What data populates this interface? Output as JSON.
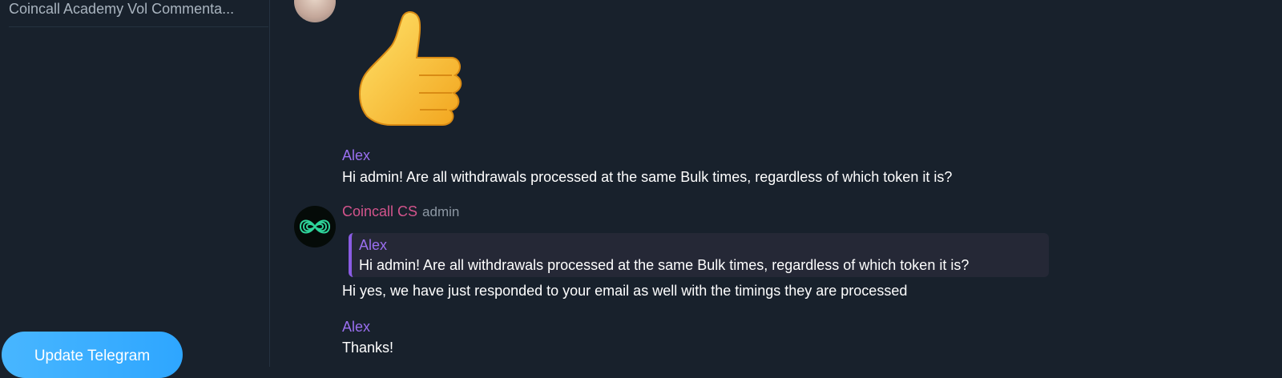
{
  "sidebar": {
    "chats": [
      {
        "title": "Coincall Academy Vol Commenta..."
      }
    ],
    "update_button": "Update Telegram"
  },
  "messages": [
    {
      "type": "sticker",
      "icon": "thumbs-up-sticker"
    },
    {
      "sender": "Alex",
      "sender_color": "#9a6ff0",
      "text": "Hi admin! Are all withdrawals processed at the same Bulk times, regardless of which token it is?"
    },
    {
      "sender": "Coincall CS",
      "sender_color": "#d3548c",
      "role": "admin",
      "reply": {
        "sender": "Alex",
        "text": "Hi admin! Are all withdrawals processed at the same Bulk times, regardless of which token it is?"
      },
      "text": "Hi yes, we have just responded to your email as well with the timings they are processed"
    },
    {
      "sender": "Alex",
      "sender_color": "#9a6ff0",
      "text": "Thanks!"
    }
  ]
}
